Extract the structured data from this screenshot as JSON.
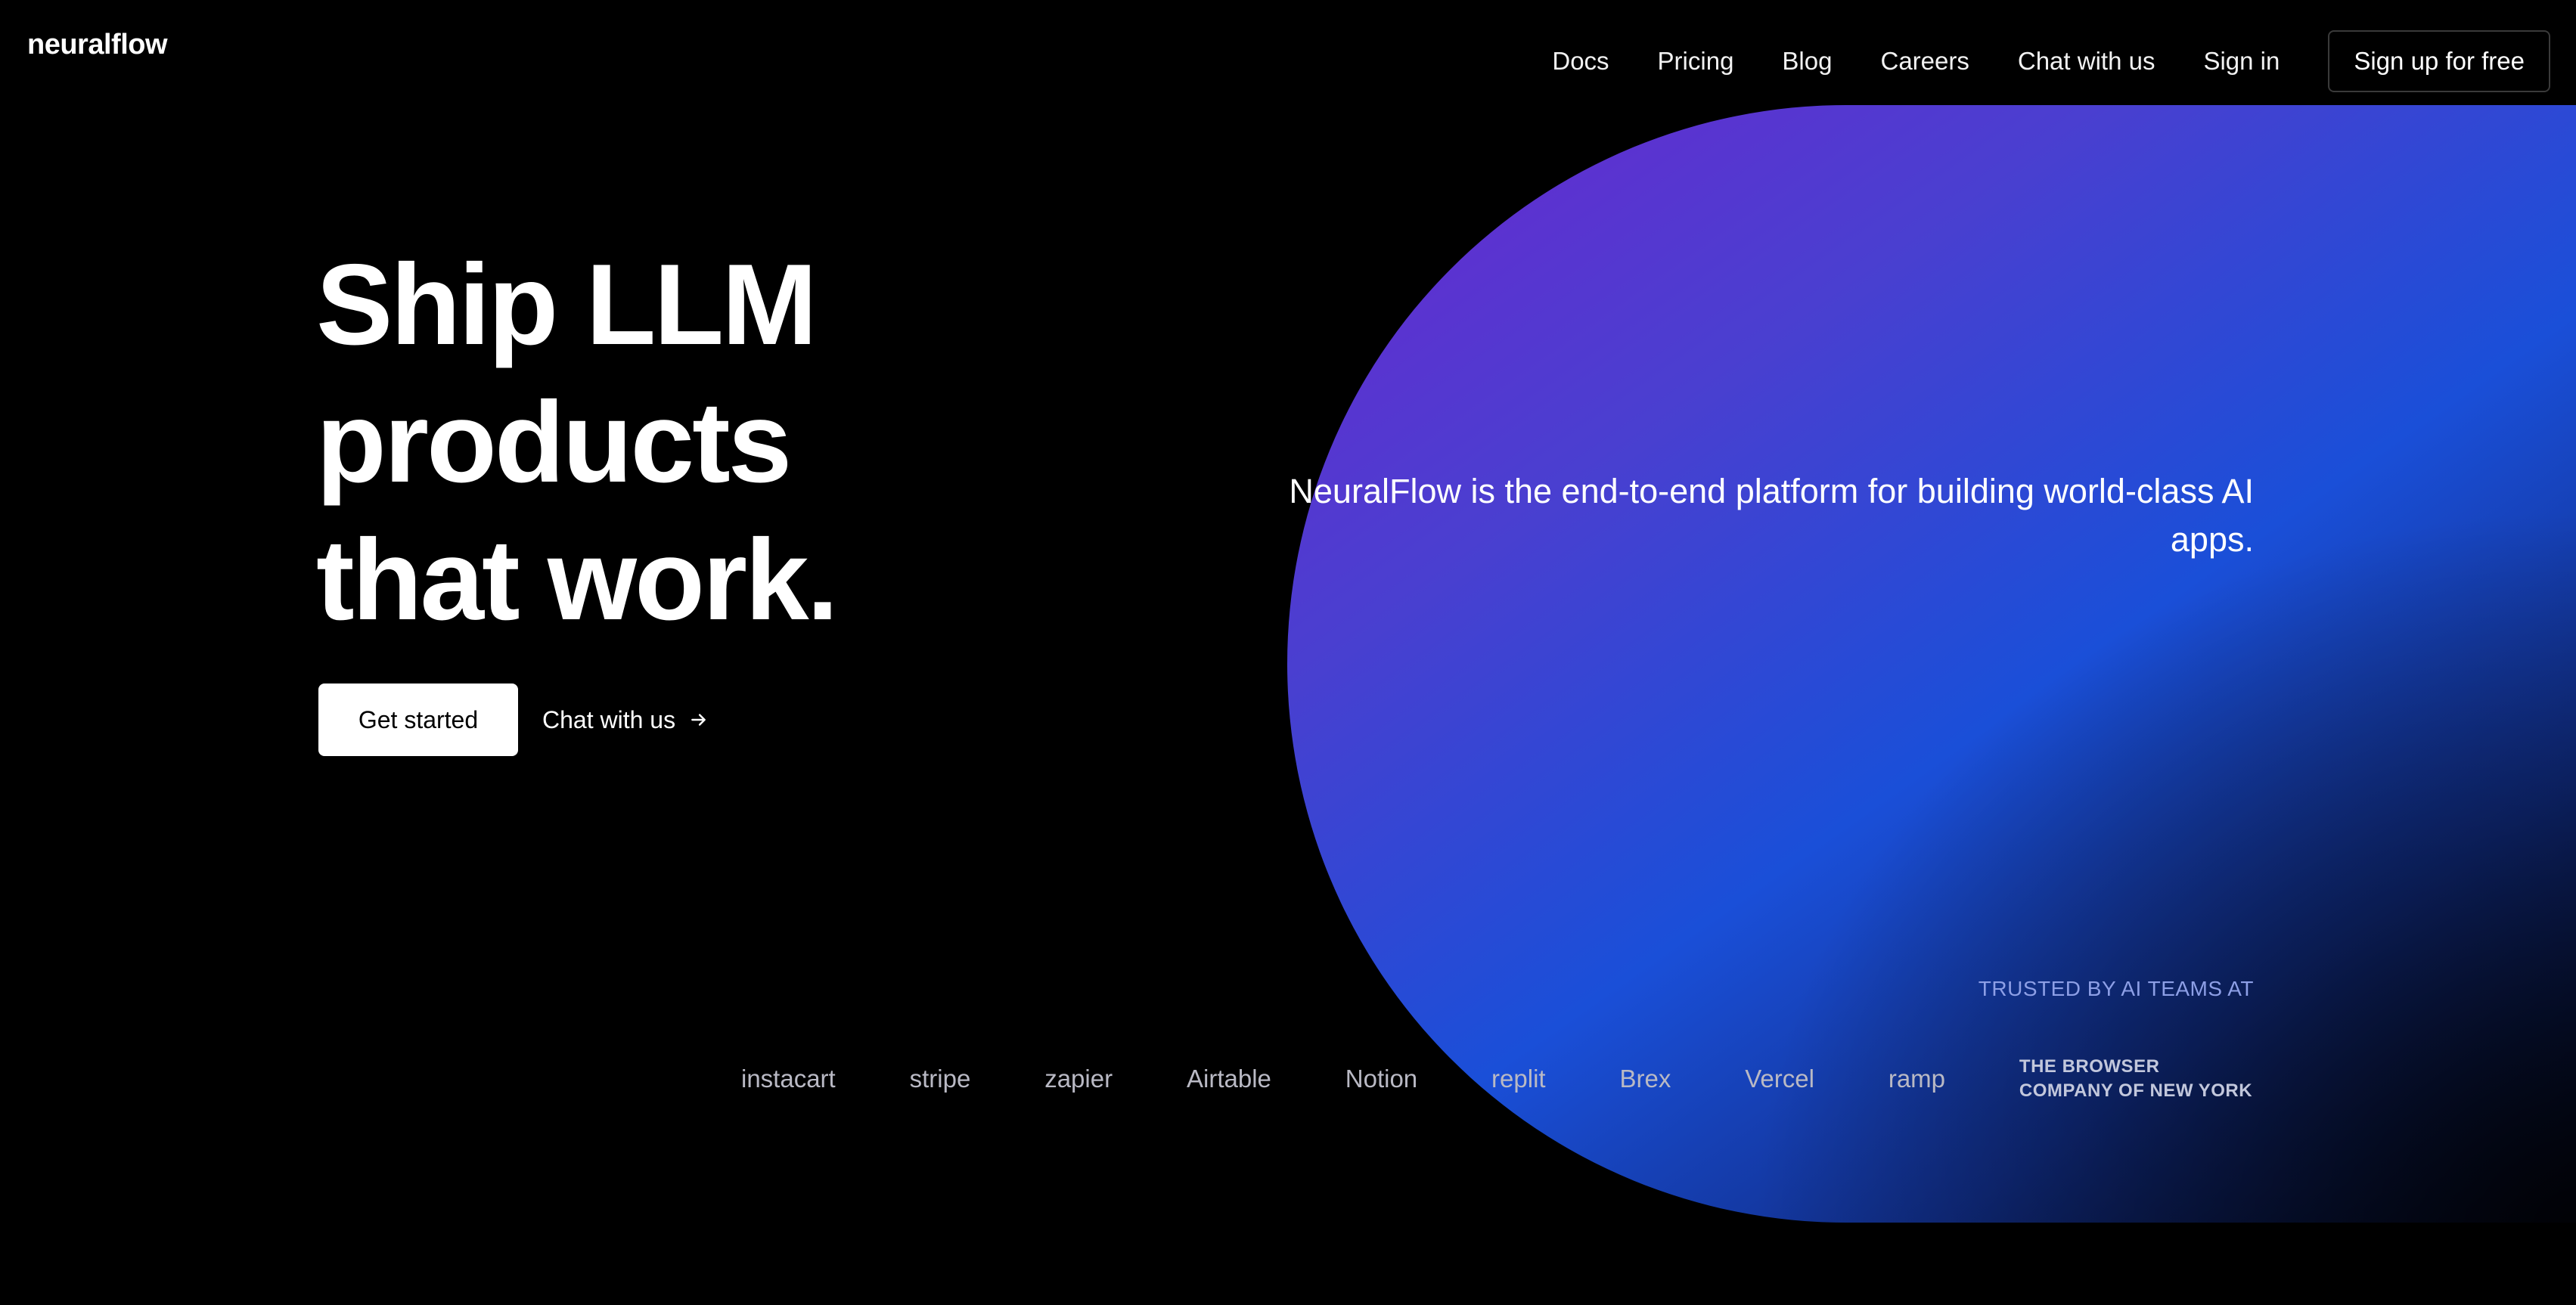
{
  "brand": {
    "name": "neuralflow"
  },
  "nav": {
    "links": [
      "Docs",
      "Pricing",
      "Blog",
      "Careers",
      "Chat with us",
      "Sign in"
    ],
    "signup_label": "Sign up for free"
  },
  "hero": {
    "headline_lines": [
      "Ship LLM",
      "products",
      "that work."
    ],
    "primary_cta": "Get started",
    "secondary_cta": "Chat with us",
    "tagline": "NeuralFlow is the end-to-end platform for building world-class AI apps."
  },
  "trusted": {
    "label": "TRUSTED BY AI TEAMS AT",
    "logos": [
      "instacart",
      "stripe",
      "zapier",
      "Airtable",
      "Notion",
      "replit",
      "Brex",
      "Vercel",
      "ramp",
      "THE BROWSER COMPANY OF NEW YORK"
    ]
  },
  "colors": {
    "background": "#000000",
    "gradient_start": "#6b27cf",
    "gradient_mid": "#1a4fd8",
    "gradient_end": "#050a24",
    "trusted_label": "#8d9fe6"
  },
  "icons": {
    "secondary_cta_icon": "arrow-right-icon"
  }
}
